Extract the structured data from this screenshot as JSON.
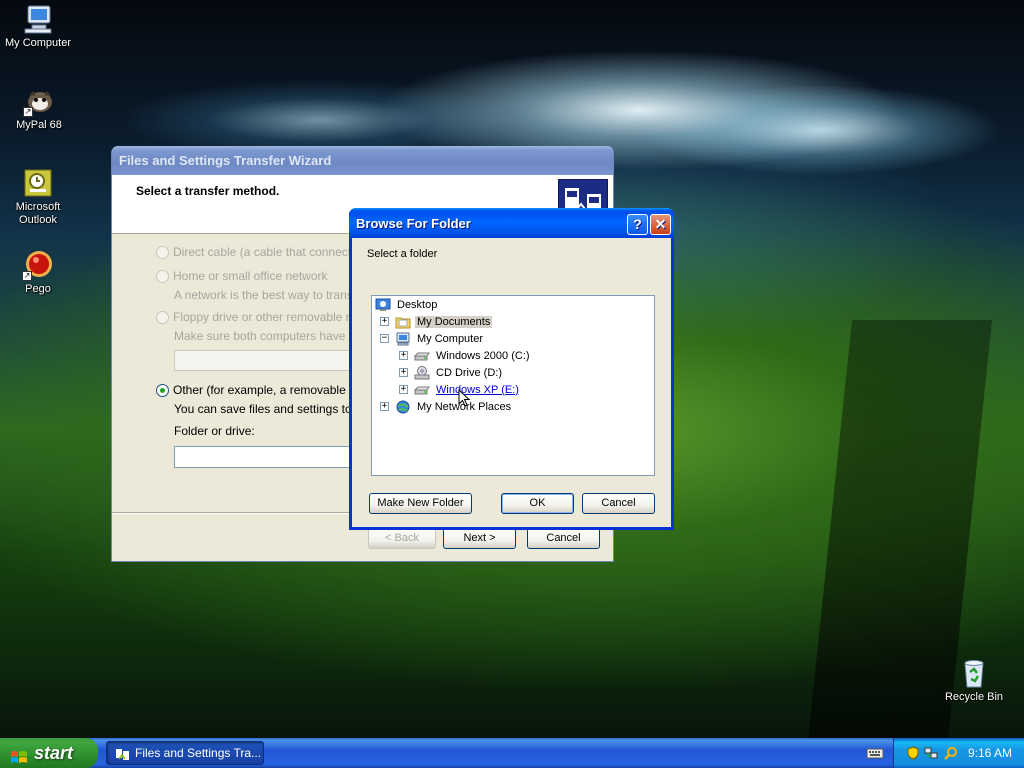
{
  "desktop": {
    "icons": [
      {
        "label": "My Computer",
        "icon": "my-computer-icon"
      },
      {
        "label": "MyPal 68",
        "icon": "mypal-icon"
      },
      {
        "label": "Microsoft Outlook",
        "icon": "outlook-icon"
      },
      {
        "label": "Pego",
        "icon": "pego-icon"
      },
      {
        "label": "Recycle Bin",
        "icon": "recycle-bin-icon"
      }
    ]
  },
  "wizard": {
    "title": "Files and Settings Transfer Wizard",
    "heading": "Select a transfer method.",
    "options": [
      {
        "label": "Direct cable (a cable that connects yo",
        "enabled": false,
        "selected": false
      },
      {
        "label": "Home or small office network",
        "sublabel": "A network is the best way to transfer",
        "enabled": false,
        "selected": false
      },
      {
        "label": "Floppy drive or other removable media",
        "sublabel": "Make sure both computers have the",
        "enabled": false,
        "selected": false
      },
      {
        "label": "Other (for example, a removable drive",
        "sublabel": "You can save files and settings to an",
        "enabled": true,
        "selected": true
      }
    ],
    "folder_label": "Folder or drive:",
    "folder_value": "",
    "buttons": {
      "back": "< Back",
      "next": "Next >",
      "cancel": "Cancel"
    }
  },
  "browse": {
    "title": "Browse For Folder",
    "help_glyph": "?",
    "close_glyph": "✕",
    "prompt": "Select a folder",
    "tree": [
      {
        "label": "Desktop",
        "icon": "desktop-icon",
        "level": 0,
        "expander": ""
      },
      {
        "label": "My Documents",
        "icon": "folder-icon",
        "level": 1,
        "expander": "+",
        "selected": true
      },
      {
        "label": "My Computer",
        "icon": "computer-icon",
        "level": 1,
        "expander": "−"
      },
      {
        "label": "Windows 2000 (C:)",
        "icon": "drive-icon",
        "level": 2,
        "expander": "+"
      },
      {
        "label": "CD Drive (D:)",
        "icon": "cd-drive-icon",
        "level": 2,
        "expander": "+"
      },
      {
        "label": "Windows XP (E:)",
        "icon": "drive-icon",
        "level": 2,
        "expander": "+",
        "hover": true
      },
      {
        "label": "My Network Places",
        "icon": "network-icon",
        "level": 1,
        "expander": "+"
      }
    ],
    "buttons": {
      "new_folder": "Make New Folder",
      "ok": "OK",
      "cancel": "Cancel"
    }
  },
  "taskbar": {
    "start_label": "start",
    "task_item": "Files and Settings Tra...",
    "clock": "9:16 AM"
  },
  "colors": {
    "title_active": "#0055e8",
    "title_inactive": "#7d98cf",
    "taskbar": "#245edb",
    "start_green": "#3c9a3c",
    "dialog_bg": "#ece9d8"
  }
}
